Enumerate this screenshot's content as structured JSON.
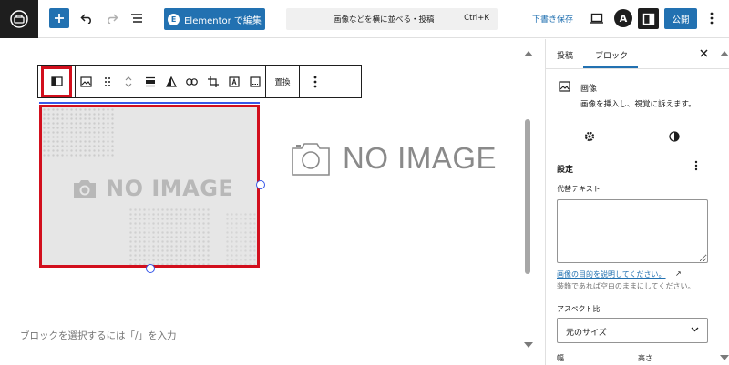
{
  "topbar": {
    "elementor_label": "Elementor で編集",
    "elementor_badge": "E",
    "command_title": "画像などを横に並べる・投稿",
    "command_shortcut": "Ctrl+K",
    "draft_label": "下書き保存",
    "astra_label": "A",
    "publish_label": "公開"
  },
  "block_toolbar": {
    "replace_label": "置換"
  },
  "canvas": {
    "image_placeholder_text": "NO IMAGE",
    "second_image_text": "NO IMAGE",
    "block_placeholder": "ブロックを選択するには「/」を入力"
  },
  "sidebar": {
    "tabs": [
      "投稿",
      "ブロック"
    ],
    "active_tab": "ブロック",
    "block_card": {
      "title": "画像",
      "description": "画像を挿入し、視覚に訴えます。"
    },
    "settings_heading": "設定",
    "alt_text_label": "代替テキスト",
    "alt_text_value": "",
    "alt_link": "画像の目的を説明してください。",
    "alt_help": "装飾であれば空白のままにしてください。",
    "aspect_label": "アスペクト比",
    "aspect_value": "元のサイズ",
    "width_label": "幅",
    "height_label": "高さ"
  },
  "colors": {
    "accent": "#2271b1",
    "highlight_box": "#d20f1d",
    "selection": "#3858e9",
    "dark": "#1e1e1e"
  },
  "icons": [
    "wordpress-logo-icon",
    "plus-icon",
    "undo-icon",
    "redo-icon",
    "list-view-icon",
    "preview-icon",
    "settings-panel-icon",
    "more-vertical-icon",
    "close-icon",
    "gear-icon",
    "styles-icon",
    "image-icon",
    "external-link-icon",
    "chevron-down-icon"
  ]
}
